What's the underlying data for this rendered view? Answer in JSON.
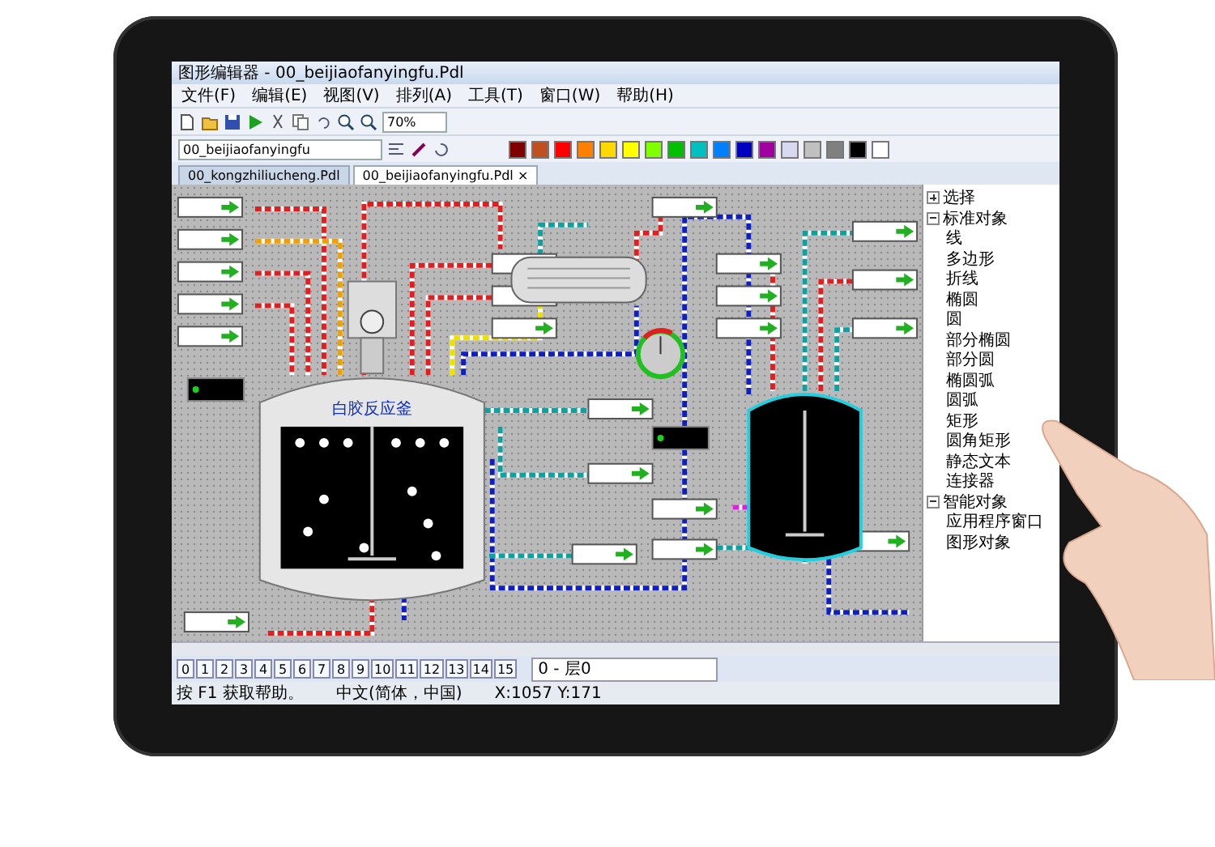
{
  "window": {
    "title": "图形编辑器 - 00_beijiaofanyingfu.Pdl"
  },
  "menu": [
    "文件(F)",
    "编辑(E)",
    "视图(V)",
    "排列(A)",
    "工具(T)",
    "窗口(W)",
    "帮助(H)"
  ],
  "toolbar": {
    "object_combo": "00_beijiaofanyingfu",
    "zoom": "70%"
  },
  "palette": [
    {
      "color": "#800000"
    },
    {
      "color": "#c05020"
    },
    {
      "color": "#ff0000"
    },
    {
      "color": "#ff8000"
    },
    {
      "color": "#ffd800"
    },
    {
      "color": "#ffff00"
    },
    {
      "color": "#80ff00"
    },
    {
      "color": "#00c000"
    },
    {
      "color": "#00c0c0"
    },
    {
      "color": "#0080ff"
    },
    {
      "color": "#0000c0"
    },
    {
      "color": "#a000a0"
    },
    {
      "color": "#d8d8f0"
    },
    {
      "color": "#c0c0c0"
    },
    {
      "color": "#808080"
    },
    {
      "color": "#000000"
    },
    {
      "color": "#ffffff"
    }
  ],
  "tabs": [
    {
      "label": "00_kongzhiliucheng.Pdl",
      "selected": false
    },
    {
      "label": "00_beijiaofanyingfu.Pdl",
      "selected": true,
      "close_glyph": "×"
    }
  ],
  "diagram": {
    "vessels": [
      {
        "label": "白胶反应釜"
      }
    ]
  },
  "panel": {
    "items": [
      {
        "label": "选择",
        "expanded": false
      },
      {
        "label": "标准对象",
        "expanded": true,
        "children": [
          {
            "label": "线"
          },
          {
            "label": "多边形"
          },
          {
            "label": "折线"
          },
          {
            "label": "椭圆"
          },
          {
            "label": "圆"
          },
          {
            "label": "部分椭圆"
          },
          {
            "label": "部分圆"
          },
          {
            "label": "椭圆弧"
          },
          {
            "label": "圆弧"
          },
          {
            "label": "矩形"
          },
          {
            "label": "圆角矩形"
          },
          {
            "label": "静态文本"
          },
          {
            "label": "连接器"
          }
        ]
      },
      {
        "label": "智能对象",
        "expanded": true,
        "children": [
          {
            "label": "应用程序窗口"
          },
          {
            "label": "图形对象"
          }
        ]
      }
    ]
  },
  "layers": {
    "buttons": [
      "0",
      "1",
      "2",
      "3",
      "4",
      "5",
      "6",
      "7",
      "8",
      "9",
      "10",
      "11",
      "12",
      "13",
      "14",
      "15"
    ],
    "current": "0 - 层0"
  },
  "status_bar": {
    "help": "按 F1 获取帮助。",
    "language": "中文(简体，中国)",
    "coords": "X:1057 Y:171"
  }
}
